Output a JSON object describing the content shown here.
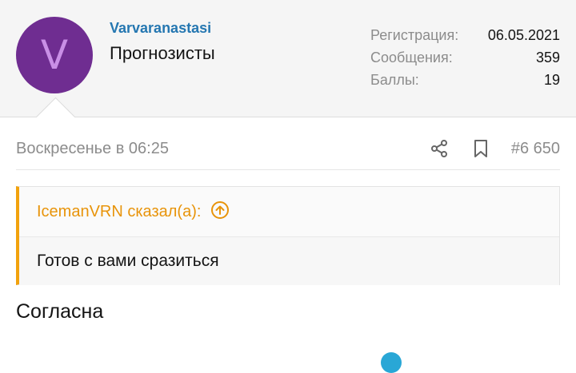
{
  "user": {
    "avatar_letter": "V",
    "name": "Varvaranastasi",
    "title": "Прогнозисты",
    "stats": [
      {
        "label": "Регистрация:",
        "value": "06.05.2021"
      },
      {
        "label": "Сообщения:",
        "value": "359"
      },
      {
        "label": "Баллы:",
        "value": "19"
      }
    ]
  },
  "post": {
    "date": "Воскресенье в 06:25",
    "number": "#6 650",
    "quote": {
      "author": "IcemanVRN сказал(а):",
      "text": "Готов с вами сразиться"
    },
    "text": "Согласна"
  },
  "colors": {
    "avatar_bg": "#6f2d91",
    "username": "#2577b1",
    "quote_accent": "#f2a20d"
  },
  "icons": [
    "share-icon",
    "bookmark-icon",
    "go-to-quote-icon"
  ]
}
